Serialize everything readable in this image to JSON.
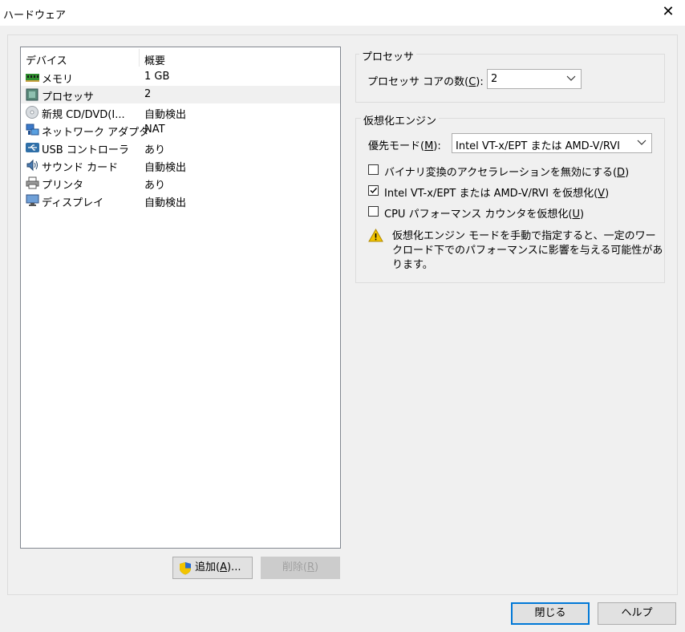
{
  "window": {
    "title": "ハードウェア",
    "close_glyph": "✕"
  },
  "devices": {
    "headers": {
      "device": "デバイス",
      "summary": "概要"
    },
    "items": [
      {
        "icon": "memory-icon",
        "name": "メモリ",
        "summary": "1 GB"
      },
      {
        "icon": "processor-icon",
        "name": "プロセッサ",
        "summary": "2"
      },
      {
        "icon": "cd-dvd-icon",
        "name": "新規 CD/DVD(I...",
        "summary": "自動検出"
      },
      {
        "icon": "network-adapter-icon",
        "name": "ネットワーク アダプタ",
        "summary": "NAT"
      },
      {
        "icon": "usb-controller-icon",
        "name": "USB コントローラ",
        "summary": "あり"
      },
      {
        "icon": "sound-card-icon",
        "name": "サウンド カード",
        "summary": "自動検出"
      },
      {
        "icon": "printer-icon",
        "name": "プリンタ",
        "summary": "あり"
      },
      {
        "icon": "display-icon",
        "name": "ディスプレイ",
        "summary": "自動検出"
      }
    ],
    "selected_index": 1
  },
  "buttons": {
    "add_prefix": "追加(",
    "add_key": "A",
    "add_suffix": ")...",
    "remove_prefix": "削除(",
    "remove_key": "R",
    "remove_suffix": ")",
    "close": "閉じる",
    "help": "ヘルプ"
  },
  "processor": {
    "group_label": "プロセッサ",
    "cores_label_prefix": "プロセッサ コアの数(",
    "cores_label_key": "C",
    "cores_label_suffix": "):",
    "cores_value": "2"
  },
  "virtualization": {
    "group_label": "仮想化エンジン",
    "mode_label_prefix": "優先モード(",
    "mode_label_key": "M",
    "mode_label_suffix": "):",
    "mode_value": "Intel VT-x/EPT または AMD-V/RVI",
    "options": [
      {
        "prefix": "バイナリ変換のアクセラレーションを無効にする(",
        "key": "D",
        "suffix": ")",
        "checked": false
      },
      {
        "prefix": "Intel VT-x/EPT または AMD-V/RVI を仮想化(",
        "key": "V",
        "suffix": ")",
        "checked": true
      },
      {
        "prefix": "CPU パフォーマンス カウンタを仮想化(",
        "key": "U",
        "suffix": ")",
        "checked": false
      }
    ],
    "warning_line1": "仮想化エンジン モードを手動で指定すると、一定のワー",
    "warning_line2": "クロード下でのパフォーマンスに影響を与える可能性があ",
    "warning_line3": "ります。"
  },
  "colors": {
    "accent": "#0078d7",
    "warning": "#f2c400",
    "selection": "#f0f0f0"
  }
}
